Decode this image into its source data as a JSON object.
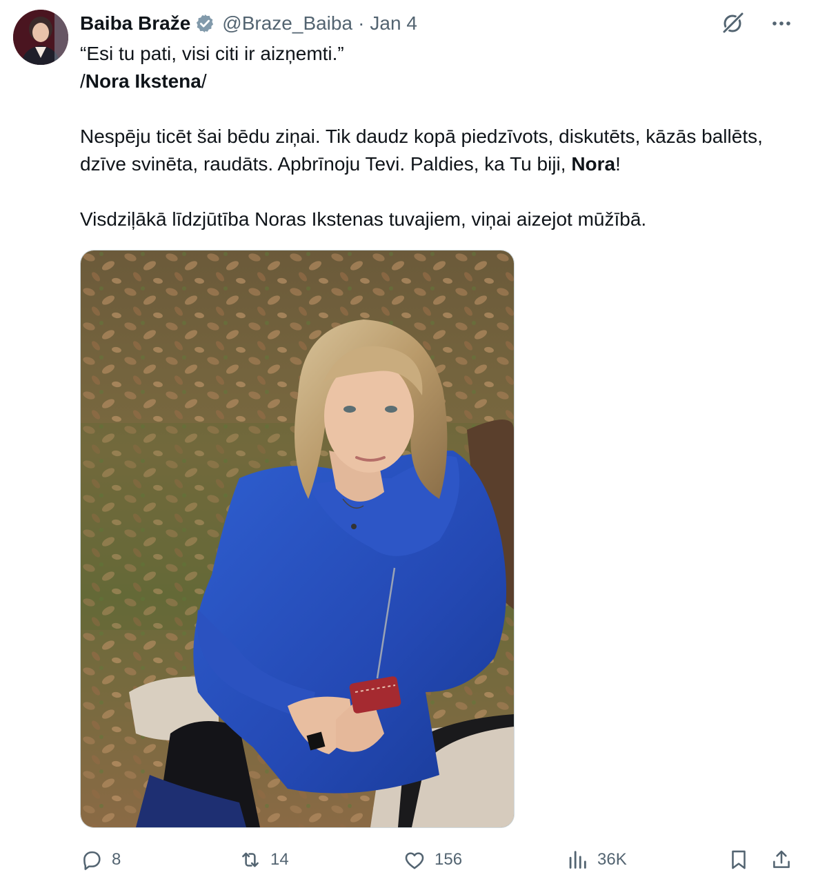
{
  "author": {
    "name": "Baiba Braže",
    "handle": "@Braze_Baiba",
    "separator": "·",
    "date": "Jan 4",
    "verified_color": "#829aab"
  },
  "tweet": {
    "line1": "“Esi tu pati, visi citi ir aizņemti.”",
    "line2_prefix": "/",
    "line2_bold": "Nora Ikstena",
    "line2_suffix": "/",
    "para2_text": "Nespēju ticēt šai bēdu ziņai. Tik daudz kopā piedzīvots, diskutēts, kāzās ballēts, dzīve svinēta, raudāts. Apbrīnoju Tevi. Paldies, ka Tu biji, ",
    "para2_bold": "Nora",
    "para2_end": "!",
    "para3": "Visdziļākā līdzjūtība Noras Ikstenas tuvajiem, viņai aizejot mūžībā."
  },
  "actions": {
    "replies": "8",
    "reposts": "14",
    "likes": "156",
    "views": "36K"
  },
  "icons": [
    "verified-badge-icon",
    "grok-icon",
    "more-icon",
    "reply-icon",
    "repost-icon",
    "like-icon",
    "views-icon",
    "bookmark-icon",
    "share-icon"
  ],
  "colors": {
    "text": "#0f1419",
    "secondary": "#536471",
    "border": "#cfd9de"
  }
}
